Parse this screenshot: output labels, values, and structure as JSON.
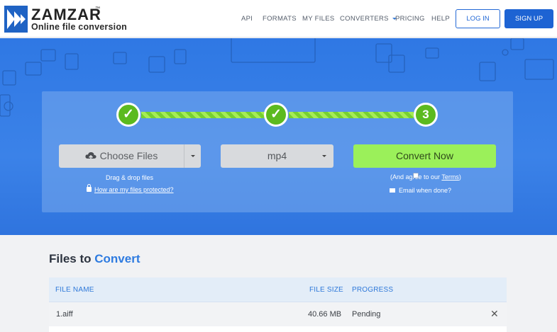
{
  "brand": {
    "name": "ZAMZAR",
    "tm": "™",
    "tagline": "Online file conversion"
  },
  "nav": {
    "items": [
      "API",
      "FORMATS",
      "MY FILES",
      "CONVERTERS",
      "PRICING",
      "HELP"
    ],
    "login": "LOG IN",
    "signup": "SIGN UP"
  },
  "converter": {
    "steps": [
      {
        "state": "done",
        "glyph": "✓"
      },
      {
        "state": "done",
        "glyph": "✓"
      },
      {
        "state": "current",
        "glyph": "3"
      }
    ],
    "choose_label": "Choose Files",
    "drag_drop": "Drag & drop files",
    "protected_link": "How are my files protected?",
    "format_value": "mp4",
    "convert_label": "Convert Now",
    "agree_prefix": "(And agree to our ",
    "terms_link": "Terms",
    "agree_suffix": ")",
    "email_label": "Email when done?",
    "email_checked": false,
    "colors": {
      "accent_green": "#9bf05a",
      "brand_blue": "#1d63d3"
    }
  },
  "files": {
    "title_part1": "Files to",
    "title_part2": "Convert",
    "columns": {
      "name": "FILE NAME",
      "size": "FILE SIZE",
      "progress": "PROGRESS"
    },
    "rows": [
      {
        "name": "1.aiff",
        "size": "40.66 MB",
        "progress": "Pending",
        "remove": "✕"
      }
    ]
  }
}
